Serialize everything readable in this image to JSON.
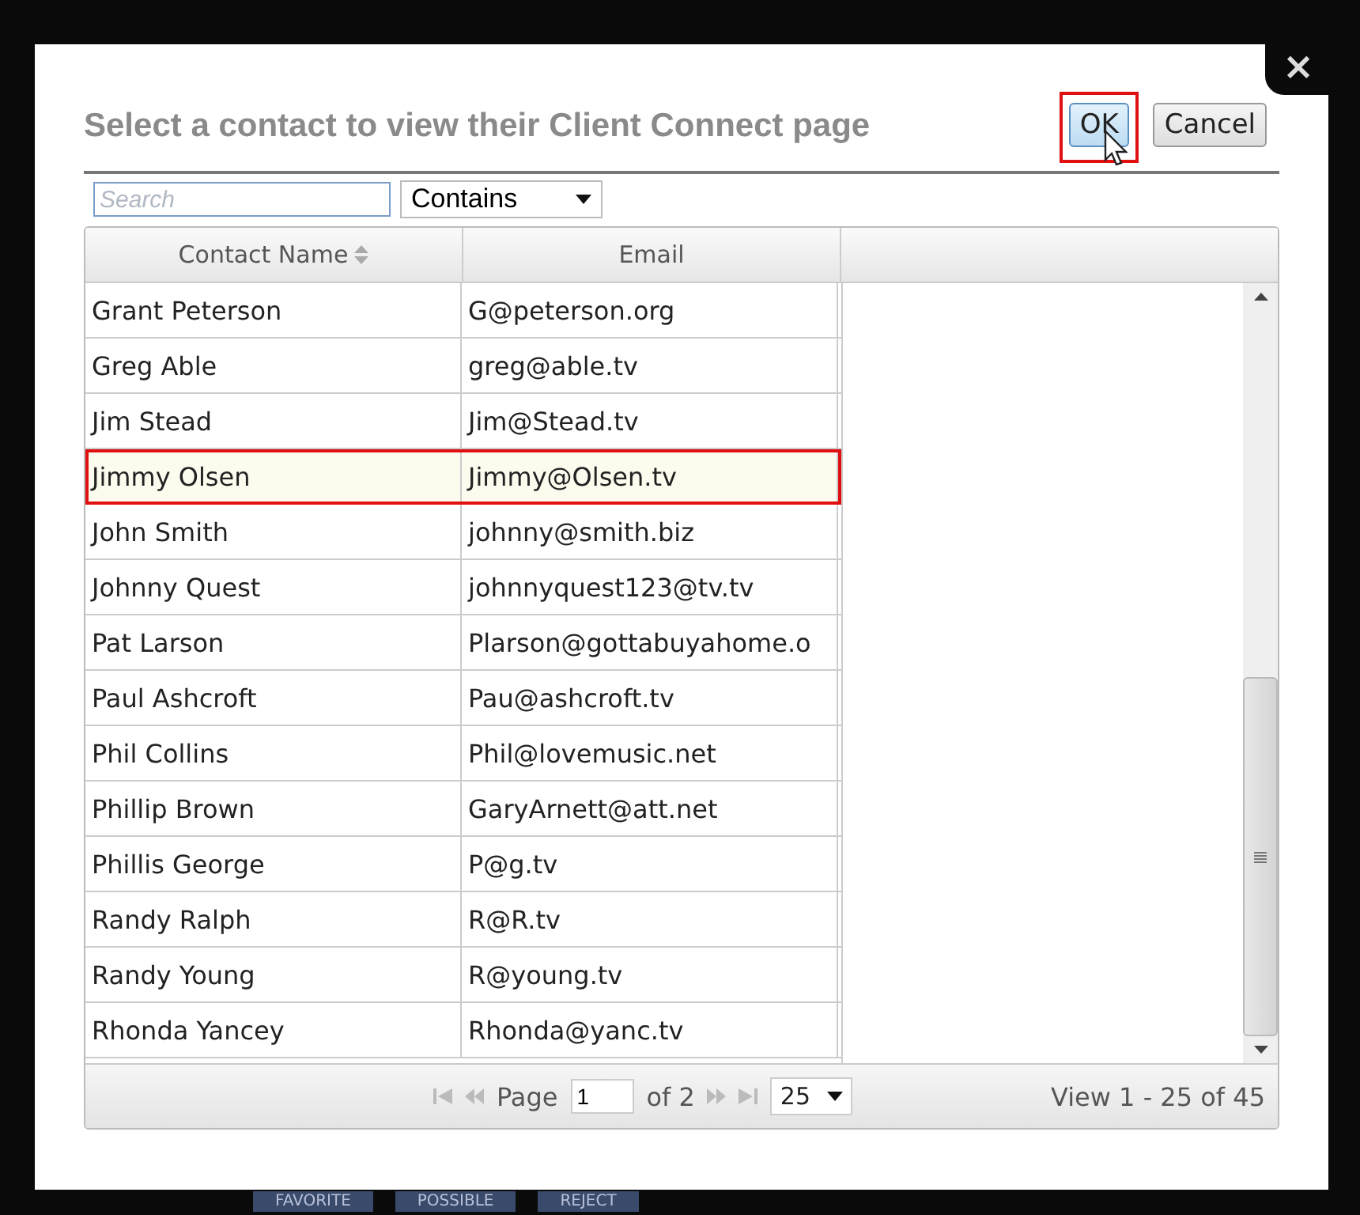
{
  "dialog": {
    "title": "Select a contact to view their Client Connect page",
    "close_label": "×",
    "buttons": [
      {
        "label": "OK",
        "kind": "primary",
        "highlighted": true
      },
      {
        "label": "Cancel",
        "kind": "secondary",
        "highlighted": false
      }
    ]
  },
  "filter": {
    "placeholder": "Search",
    "match": "Contains"
  },
  "table": {
    "columns": [
      {
        "label": "Contact Name",
        "sorted": true
      },
      {
        "label": "Email",
        "sorted": false
      }
    ],
    "rows": [
      {
        "name": "Grant Peterson",
        "email": "G@peterson.org",
        "selected": false
      },
      {
        "name": "Greg Able",
        "email": "greg@able.tv",
        "selected": false
      },
      {
        "name": "Jim Stead",
        "email": "Jim@Stead.tv",
        "selected": false
      },
      {
        "name": "Jimmy Olsen",
        "email": "Jimmy@Olsen.tv",
        "selected": true
      },
      {
        "name": "John Smith",
        "email": "johnny@smith.biz",
        "selected": false
      },
      {
        "name": "Johnny Quest",
        "email": "johnnyquest123@tv.tv",
        "selected": false
      },
      {
        "name": "Pat Larson",
        "email": "Plarson@gottabuyahome.o",
        "selected": false
      },
      {
        "name": "Paul Ashcroft",
        "email": "Pau@ashcroft.tv",
        "selected": false
      },
      {
        "name": "Phil Collins",
        "email": "Phil@lovemusic.net",
        "selected": false
      },
      {
        "name": "Phillip Brown",
        "email": "GaryArnett@att.net",
        "selected": false
      },
      {
        "name": "Phillis George",
        "email": "P@g.tv",
        "selected": false
      },
      {
        "name": "Randy Ralph",
        "email": "R@R.tv",
        "selected": false
      },
      {
        "name": "Randy Young",
        "email": "R@young.tv",
        "selected": false
      },
      {
        "name": "Rhonda Yancey",
        "email": "Rhonda@yanc.tv",
        "selected": false
      }
    ]
  },
  "pager": {
    "page_label": "Page",
    "page": "1",
    "of_label": "of 2",
    "page_size": "25",
    "summary": "View 1 - 25 of 45"
  },
  "background_buttons": [
    "FAVORITE",
    "POSSIBLE",
    "REJECT"
  ]
}
